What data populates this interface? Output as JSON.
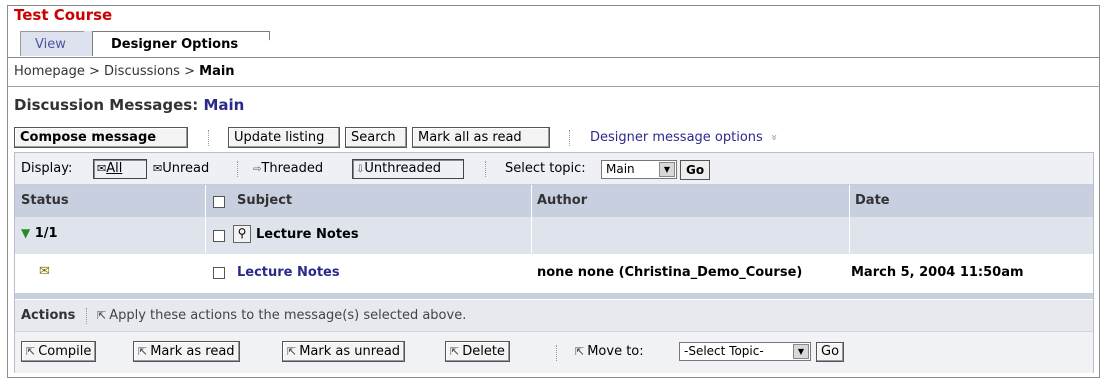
{
  "course": {
    "title": "Test Course"
  },
  "tabs": [
    {
      "label": "View"
    },
    {
      "label": "Designer Options"
    }
  ],
  "breadcrumb": {
    "items": [
      "Homepage",
      "Discussions"
    ],
    "separator": ">",
    "current": "Main"
  },
  "heading": {
    "prefix": "Discussion Messages:",
    "topic": "Main"
  },
  "toolbar": {
    "compose": "Compose message",
    "update": "Update listing",
    "search": "Search",
    "mark_all": "Mark all as read",
    "designer_options": "Designer message options",
    "designer_chevron": "»"
  },
  "display": {
    "label": "Display:",
    "all": "All",
    "unread": "Unread",
    "threaded": "Threaded",
    "unthreaded": "Unthreaded",
    "select_topic_label": "Select topic:",
    "topic_value": "Main",
    "go": "Go"
  },
  "table": {
    "headers": {
      "status": "Status",
      "subject": "Subject",
      "author": "Author",
      "date": "Date"
    },
    "thread_row": {
      "status": "1/1",
      "subject": "Lecture Notes"
    },
    "message_row": {
      "subject": "Lecture Notes",
      "author": "none none (Christina_Demo_Course)",
      "date": "March 5, 2004 11:50am"
    }
  },
  "actions": {
    "label": "Actions",
    "hint": "Apply these actions to the message(s) selected above.",
    "compile": "Compile",
    "mark_read": "Mark as read",
    "mark_unread": "Mark as unread",
    "delete": "Delete",
    "move_to_label": "Move to:",
    "move_select": "-Select Topic-",
    "go": "Go"
  },
  "colors": {
    "title_red": "#cc0000",
    "link_blue": "#2a2a8c",
    "header_bg": "#c8d0e0",
    "panel_bg": "#dfe3ec",
    "triangle_green": "#2a8a2a"
  }
}
